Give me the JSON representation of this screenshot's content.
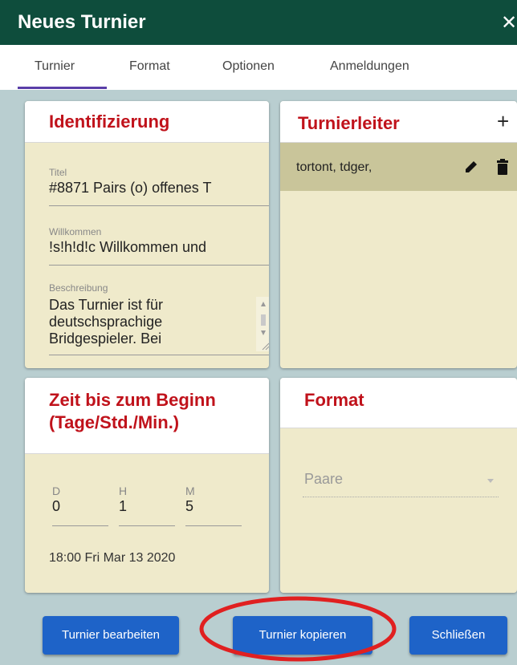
{
  "dialog": {
    "title": "Neues Turnier",
    "close_glyph": "✕"
  },
  "tabs": [
    {
      "label": "Turnier",
      "active": true
    },
    {
      "label": "Format"
    },
    {
      "label": "Optionen"
    },
    {
      "label": "Anmeldungen"
    }
  ],
  "identification": {
    "title": "Identifizierung",
    "titel_label": "Titel",
    "titel_value": "#8871 Pairs (o) offenes T",
    "willkommen_label": "Willkommen",
    "willkommen_value": "!s!h!d!c Willkommen und",
    "beschreibung_label": "Beschreibung",
    "beschreibung_value": "Das Turnier ist für deutschsprachige Bridgespieler. Bei"
  },
  "directors": {
    "title": "Turnierleiter",
    "add_glyph": "+",
    "entries": [
      "tortont, tdger,"
    ],
    "icons": [
      "pencil-icon",
      "trash-icon"
    ]
  },
  "start_time": {
    "title": "Zeit bis zum Beginn (Tage/Std./Min.)",
    "days_label": "D",
    "days_value": "0",
    "hours_label": "H",
    "hours_value": "1",
    "minutes_label": "M",
    "minutes_value": "5",
    "start_text": "18:00 Fri Mar 13 2020"
  },
  "format": {
    "title": "Format",
    "select_value": "Paare",
    "select_icon": "chevron-down-icon"
  },
  "buttons": {
    "edit": "Turnier bearbeiten",
    "copy": "Turnier kopieren",
    "close": "Schließen"
  },
  "colors": {
    "titlebar": "#0e4d3c",
    "accent_red": "#c0121b",
    "card_bg": "#efeacb",
    "director_row_bg": "#c9c59a",
    "button": "#1e63c8",
    "annotation": "#e02020"
  }
}
